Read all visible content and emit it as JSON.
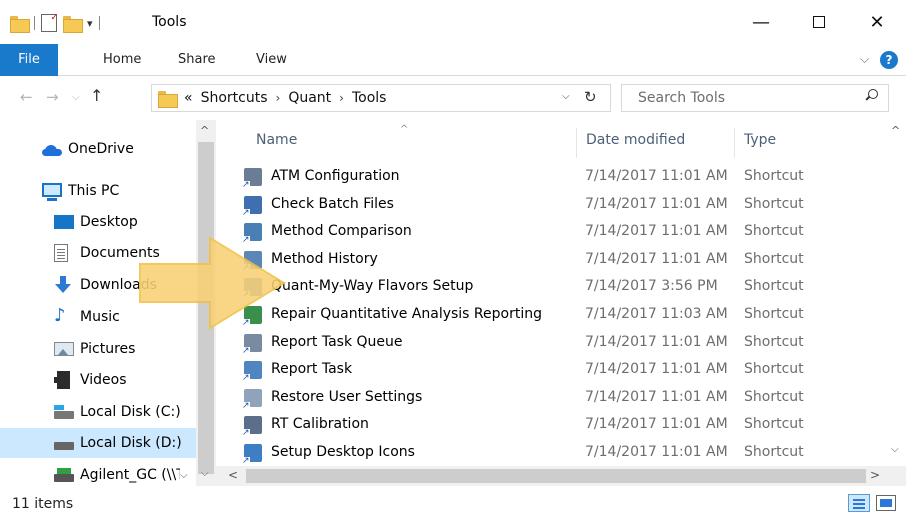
{
  "window": {
    "title": "Tools",
    "qat_dropdown": "▾",
    "minimize": "—",
    "close": "✕"
  },
  "ribbon": {
    "tabs": [
      "File",
      "Home",
      "Share",
      "View"
    ],
    "expand_chevron": "⌵",
    "help": "?"
  },
  "address": {
    "overflow": "«",
    "crumbs": [
      "Shortcuts",
      "Quant",
      "Tools"
    ],
    "separator": "›",
    "dropdown": "⌵",
    "refresh": "↻"
  },
  "search": {
    "placeholder": "Search Tools"
  },
  "nav": {
    "items": [
      {
        "label": "OneDrive",
        "icon": "onedrive-icon"
      },
      {
        "label": "This PC",
        "icon": "this-pc-icon"
      },
      {
        "label": "Desktop",
        "icon": "desktop-folder-icon"
      },
      {
        "label": "Documents",
        "icon": "documents-folder-icon"
      },
      {
        "label": "Downloads",
        "icon": "downloads-folder-icon"
      },
      {
        "label": "Music",
        "icon": "music-folder-icon"
      },
      {
        "label": "Pictures",
        "icon": "pictures-folder-icon"
      },
      {
        "label": "Videos",
        "icon": "videos-folder-icon"
      },
      {
        "label": "Local Disk (C:)",
        "icon": "local-disk-c-icon"
      },
      {
        "label": "Local Disk (D:)",
        "icon": "local-disk-d-icon",
        "selected": true
      },
      {
        "label": "Agilent_GC (\\\\T\\",
        "icon": "network-drive-icon"
      }
    ],
    "expand_caret": "⌵"
  },
  "columns": {
    "name": "Name",
    "date": "Date modified",
    "type": "Type",
    "sort_indicator": "^"
  },
  "files": [
    {
      "name": "ATM Configuration",
      "date": "7/14/2017 11:01 AM",
      "type": "Shortcut",
      "color": "#6b7c95"
    },
    {
      "name": "Check Batch Files",
      "date": "7/14/2017 11:01 AM",
      "type": "Shortcut",
      "color": "#3e6fb0"
    },
    {
      "name": "Method Comparison",
      "date": "7/14/2017 11:01 AM",
      "type": "Shortcut",
      "color": "#4a7fb5"
    },
    {
      "name": "Method History",
      "date": "7/14/2017 11:01 AM",
      "type": "Shortcut",
      "color": "#5d86b8"
    },
    {
      "name": "Quant-My-Way Flavors Setup",
      "date": "7/14/2017 3:56 PM",
      "type": "Shortcut",
      "color": "#5d86b8"
    },
    {
      "name": "Repair Quantitative Analysis Reporting",
      "date": "7/14/2017 11:03 AM",
      "type": "Shortcut",
      "color": "#3a8f4d"
    },
    {
      "name": "Report Task Queue",
      "date": "7/14/2017 11:01 AM",
      "type": "Shortcut",
      "color": "#7a8aa0"
    },
    {
      "name": "Report Task",
      "date": "7/14/2017 11:01 AM",
      "type": "Shortcut",
      "color": "#4f86c0"
    },
    {
      "name": "Restore User Settings",
      "date": "7/14/2017 11:01 AM",
      "type": "Shortcut",
      "color": "#8fa4bb"
    },
    {
      "name": "RT Calibration",
      "date": "7/14/2017 11:01 AM",
      "type": "Shortcut",
      "color": "#5b6f8a"
    },
    {
      "name": "Setup Desktop Icons",
      "date": "7/14/2017 11:01 AM",
      "type": "Shortcut",
      "color": "#3e7fc4"
    }
  ],
  "scroll": {
    "up": "^",
    "down": "⌵",
    "left": "<",
    "right": ">"
  },
  "status": {
    "items": "11 items"
  },
  "colors": {
    "accent": "#1979ca",
    "selection": "#cce8ff",
    "arrow_fill": "#f8d175",
    "arrow_stroke": "#f0c24a"
  }
}
